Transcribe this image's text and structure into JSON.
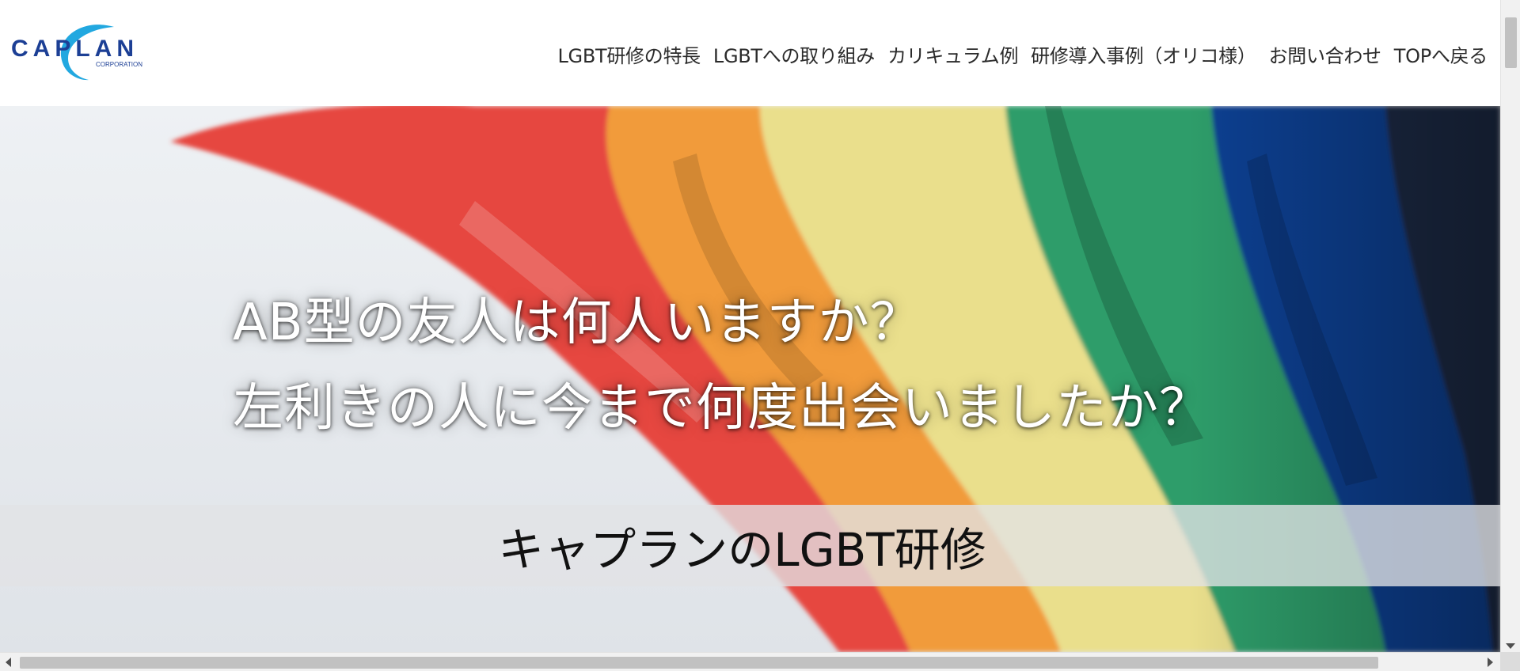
{
  "logo": {
    "text": "CAPLAN",
    "subtext": "CORPORATION"
  },
  "nav": {
    "items": [
      {
        "label": "LGBT研修の特長"
      },
      {
        "label": "LGBTへの取り組み"
      },
      {
        "label": "カリキュラム例"
      },
      {
        "label": "研修導入事例（オリコ様）"
      },
      {
        "label": "お問い合わせ"
      },
      {
        "label": "TOPへ戻る"
      }
    ]
  },
  "hero": {
    "question1": "AB型の友人は何人いますか？",
    "question2": "左利きの人に今まで何度出会いましたか？",
    "banner": "キャプランのLGBT研修",
    "image_subject": "rainbow-flag",
    "flag_colors": [
      "#e4453e",
      "#f19a3a",
      "#eedd86",
      "#2f9c6a",
      "#0f3f8f"
    ]
  }
}
